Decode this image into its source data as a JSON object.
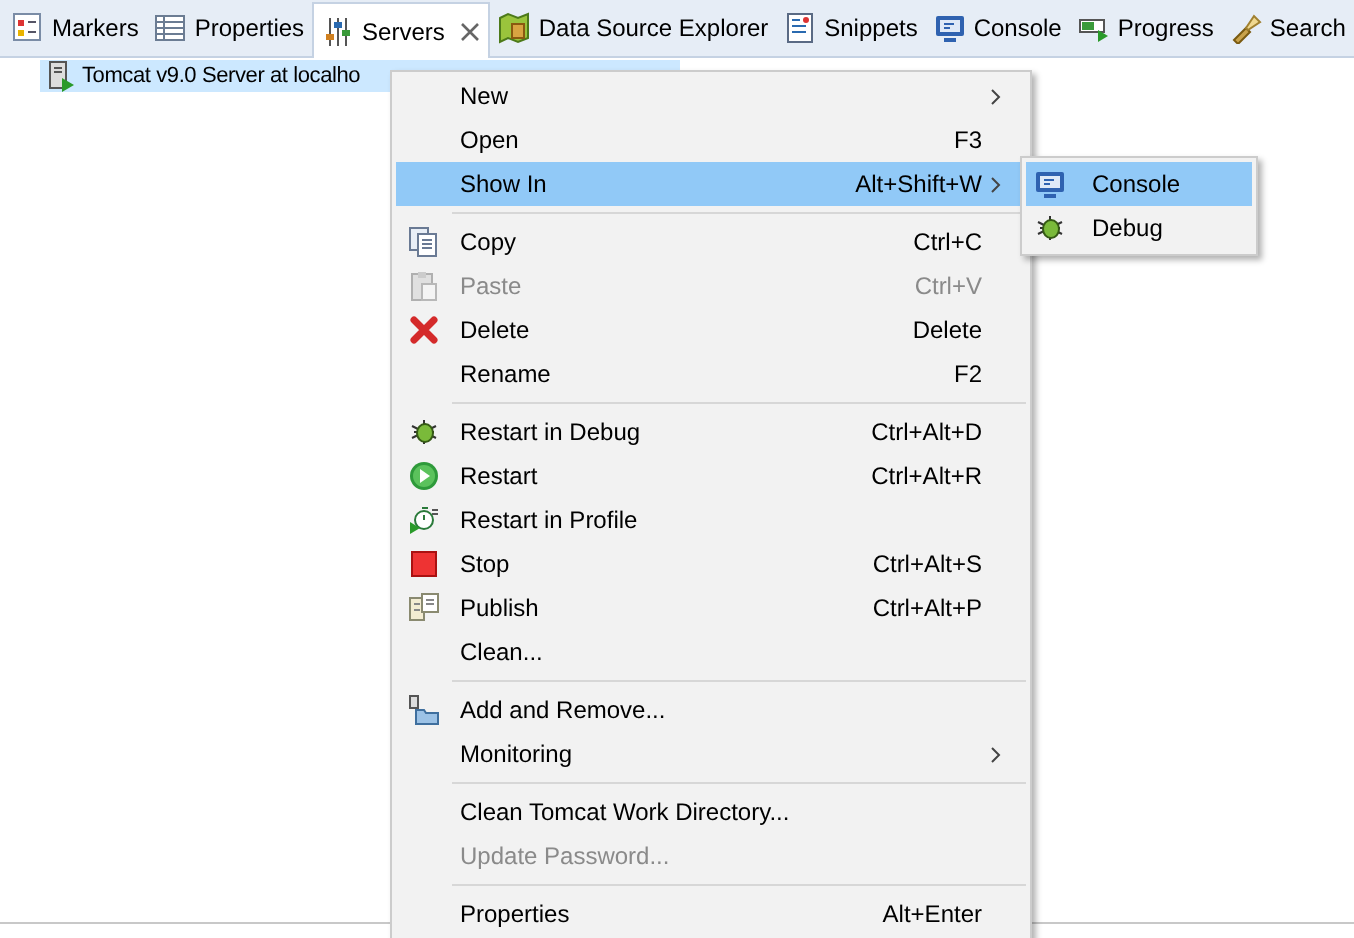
{
  "tabs": [
    {
      "label": "Markers",
      "selected": false
    },
    {
      "label": "Properties",
      "selected": false
    },
    {
      "label": "Servers",
      "selected": true,
      "closable": true
    },
    {
      "label": "Data Source Explorer",
      "selected": false
    },
    {
      "label": "Snippets",
      "selected": false
    },
    {
      "label": "Console",
      "selected": false
    },
    {
      "label": "Progress",
      "selected": false
    },
    {
      "label": "Search",
      "selected": false
    }
  ],
  "tree": [
    {
      "label": "Tomcat v9.0 Server at localho",
      "selected": true
    }
  ],
  "context_menu": [
    {
      "kind": "item",
      "label": "New",
      "has_submenu": true,
      "selected": false,
      "disabled": false
    },
    {
      "kind": "item",
      "label": "Open",
      "shortcut": "F3",
      "selected": false,
      "disabled": false
    },
    {
      "kind": "item",
      "label": "Show In",
      "shortcut": "Alt+Shift+W",
      "has_submenu": true,
      "selected": true,
      "disabled": false,
      "children": [
        {
          "label": "Console",
          "selected": true
        },
        {
          "label": "Debug",
          "selected": false
        }
      ]
    },
    {
      "kind": "separator"
    },
    {
      "kind": "item",
      "label": "Copy",
      "shortcut": "Ctrl+C",
      "selected": false,
      "disabled": false
    },
    {
      "kind": "item",
      "label": "Paste",
      "shortcut": "Ctrl+V",
      "selected": false,
      "disabled": true
    },
    {
      "kind": "item",
      "label": "Delete",
      "shortcut": "Delete",
      "selected": false,
      "disabled": false
    },
    {
      "kind": "item",
      "label": "Rename",
      "shortcut": "F2",
      "selected": false,
      "disabled": false
    },
    {
      "kind": "separator"
    },
    {
      "kind": "item",
      "label": "Restart in Debug",
      "shortcut": "Ctrl+Alt+D",
      "selected": false,
      "disabled": false
    },
    {
      "kind": "item",
      "label": "Restart",
      "shortcut": "Ctrl+Alt+R",
      "selected": false,
      "disabled": false
    },
    {
      "kind": "item",
      "label": "Restart in Profile",
      "selected": false,
      "disabled": false
    },
    {
      "kind": "item",
      "label": "Stop",
      "shortcut": "Ctrl+Alt+S",
      "selected": false,
      "disabled": false
    },
    {
      "kind": "item",
      "label": "Publish",
      "shortcut": "Ctrl+Alt+P",
      "selected": false,
      "disabled": false
    },
    {
      "kind": "item",
      "label": "Clean...",
      "selected": false,
      "disabled": false
    },
    {
      "kind": "separator"
    },
    {
      "kind": "item",
      "label": "Add and Remove...",
      "selected": false,
      "disabled": false
    },
    {
      "kind": "item",
      "label": "Monitoring",
      "has_submenu": true,
      "selected": false,
      "disabled": false
    },
    {
      "kind": "separator"
    },
    {
      "kind": "item",
      "label": "Clean Tomcat Work Directory...",
      "selected": false,
      "disabled": false
    },
    {
      "kind": "item",
      "label": "Update Password...",
      "selected": false,
      "disabled": true
    },
    {
      "kind": "separator"
    },
    {
      "kind": "item",
      "label": "Properties",
      "shortcut": "Alt+Enter",
      "selected": false,
      "disabled": false
    }
  ]
}
